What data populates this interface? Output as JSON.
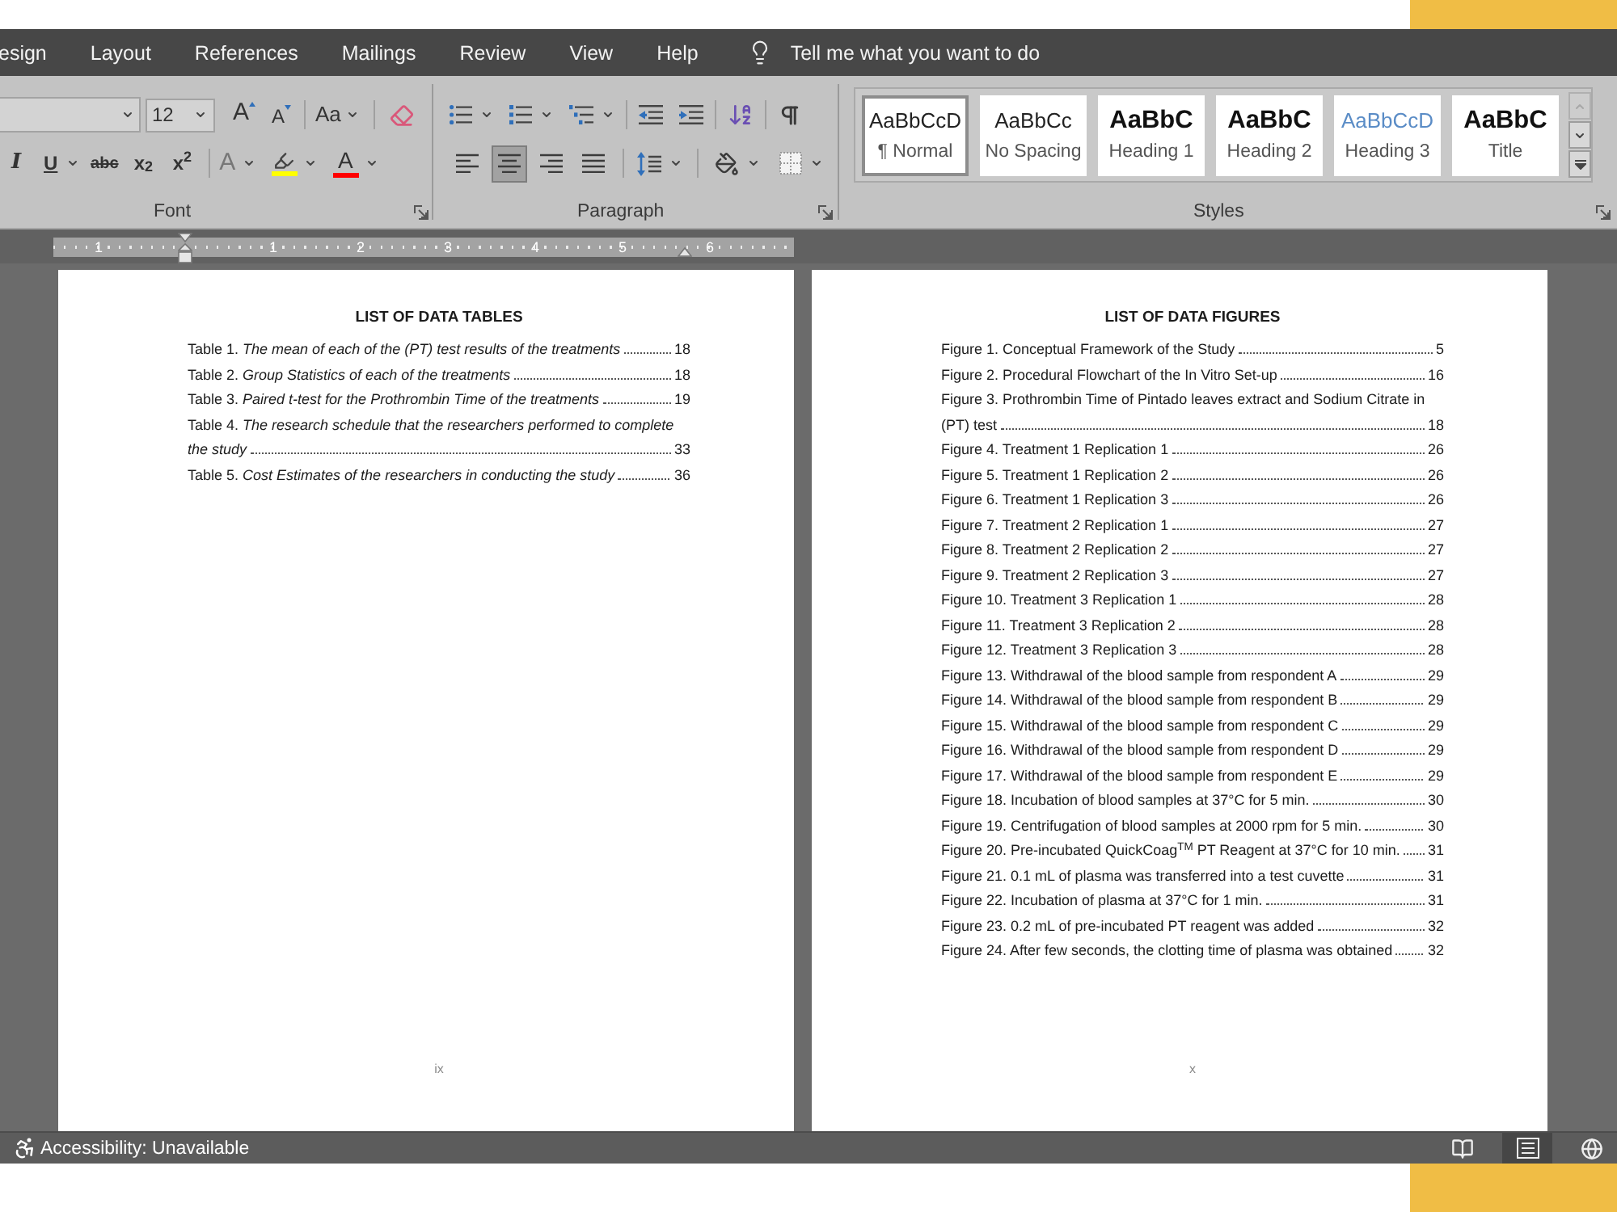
{
  "menu_bar": {
    "tabs": [
      "esign",
      "Layout",
      "References",
      "Mailings",
      "Review",
      "View",
      "Help"
    ],
    "tell_me": "Tell me what you want to do"
  },
  "ribbon": {
    "font": {
      "label": "Font",
      "font_size": "12",
      "grow": "A",
      "shrink": "A",
      "change_case": "Aa",
      "italic": "I",
      "underline": "U",
      "strikethrough": "abc",
      "subscript": "x$_{2}$",
      "superscript": "x$^{2}$",
      "text_effects": "A",
      "highlight": {
        "color": "#ffff00"
      },
      "font_color": {
        "text": "A",
        "color": "#ff0000"
      }
    },
    "paragraph": {
      "label": "Paragraph",
      "alignment": [
        {
          "selected": false
        },
        {
          "selected": true
        },
        {
          "selected": false
        },
        {
          "selected": false
        }
      ]
    },
    "styles": {
      "label": "Styles",
      "items": [
        {
          "kind": "normal",
          "preview": "AaBbCcD",
          "name": "¶ Normal",
          "selected": true
        },
        {
          "kind": "no_spacing",
          "preview": "AaBbCc",
          "name": "No Spacing",
          "selected": false
        },
        {
          "kind": "heading1",
          "preview": "AaBbC",
          "name": "Heading 1",
          "selected": false
        },
        {
          "kind": "heading2",
          "preview": "AaBbC",
          "name": "Heading 2",
          "selected": false
        },
        {
          "kind": "heading3",
          "preview": "AaBbCcD",
          "name": "Heading 3",
          "selected": false
        },
        {
          "kind": "title",
          "preview": "AaBbC",
          "name": "Title",
          "selected": false
        }
      ]
    }
  },
  "ruler": {
    "labels": [
      "1",
      "1",
      "2",
      "3",
      "4",
      "5",
      "6"
    ]
  },
  "pages": [
    {
      "heading": "LIST OF DATA TABLES",
      "entries": [
        {
          "text": "Table 1. *The mean of each of the (PT) test results of the treatments*",
          "page": "18"
        },
        {
          "text": "Table 2. *Group Statistics of each of the treatments*",
          "page": "18"
        },
        {
          "text": "Table 3. *Paired t-test for the Prothrombin Time of the treatments*",
          "page": "19"
        },
        {
          "text": "Table 4. *The research schedule that the researchers performed to complete the study*",
          "page": "33"
        },
        {
          "text": "Table 5. *Cost Estimates of the researchers in conducting the study*",
          "page": "36"
        }
      ],
      "page_number": "ix"
    },
    {
      "heading": "LIST OF DATA FIGURES",
      "entries": [
        {
          "text": "Figure 1. Conceptual Framework of the Study",
          "page": "5"
        },
        {
          "text": "Figure 2. Procedural Flowchart of the In Vitro Set-up",
          "page": "16"
        },
        {
          "text": "Figure 3. Prothrombin Time of Pintado leaves extract and Sodium Citrate in (PT) test",
          "page": "18"
        },
        {
          "text": "Figure 4. Treatment 1 Replication 1",
          "page": "26"
        },
        {
          "text": "Figure 5. Treatment 1 Replication 2",
          "page": "26"
        },
        {
          "text": "Figure 6. Treatment 1 Replication 3",
          "page": "26"
        },
        {
          "text": "Figure 7. Treatment 2 Replication 1",
          "page": "27"
        },
        {
          "text": "Figure 8. Treatment 2 Replication 2",
          "page": "27"
        },
        {
          "text": "Figure 9. Treatment 2 Replication 3",
          "page": "27"
        },
        {
          "text": "Figure 10. Treatment 3 Replication 1",
          "page": "28"
        },
        {
          "text": "Figure 11. Treatment 3 Replication 2",
          "page": "28"
        },
        {
          "text": "Figure 12. Treatment 3 Replication 3",
          "page": "28"
        },
        {
          "text": "Figure 13. Withdrawal of the blood sample from respondent A",
          "page": "29"
        },
        {
          "text": "Figure 14. Withdrawal of the blood sample from respondent B",
          "page": "29"
        },
        {
          "text": "Figure 15. Withdrawal of the blood sample from respondent C",
          "page": "29"
        },
        {
          "text": "Figure 16. Withdrawal of the blood sample from respondent D",
          "page": "29"
        },
        {
          "text": "Figure 17. Withdrawal of the blood sample from respondent E",
          "page": "29"
        },
        {
          "text": "Figure 18. Incubation of blood samples at 37°C for 5 min.",
          "page": "30"
        },
        {
          "text": "Figure 19. Centrifugation of blood samples at 2000 rpm for 5 min.",
          "page": "30"
        },
        {
          "text": "Figure 20. Pre-incubated QuickCoag$^{TM}$ PT Reagent at 37°C for 10 min.",
          "page": "31"
        },
        {
          "text": "Figure 21. 0.1 mL of plasma was transferred into a test cuvette",
          "page": "31"
        },
        {
          "text": "Figure 22. Incubation of plasma at 37°C for 1 min.",
          "page": "31"
        },
        {
          "text": "Figure 23. 0.2 mL of pre-incubated PT reagent was added",
          "page": "32"
        },
        {
          "text": "Figure 24. After few seconds, the clotting time of plasma was obtained",
          "page": "32"
        }
      ],
      "page_number": "x"
    }
  ],
  "status_bar": {
    "accessibility": "Accessibility: Unavailable",
    "views": [
      {
        "selected": false
      },
      {
        "selected": true
      },
      {
        "selected": false
      }
    ]
  }
}
